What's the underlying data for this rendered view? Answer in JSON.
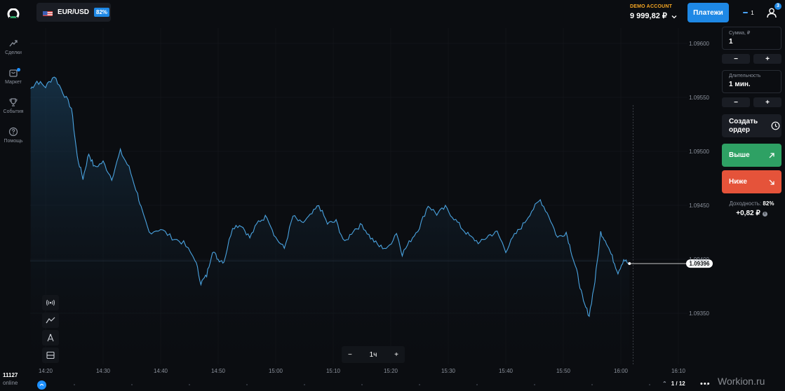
{
  "sidebar": {
    "items": [
      {
        "label": "Сделки",
        "icon": "trades-icon"
      },
      {
        "label": "Маркет",
        "icon": "market-icon"
      },
      {
        "label": "События",
        "icon": "trophy-icon"
      },
      {
        "label": "Помощь",
        "icon": "help-icon"
      }
    ],
    "online_count": "11127",
    "online_label": "online"
  },
  "header": {
    "asset": "EUR/USD",
    "asset_payout": "82%",
    "account_label": "DEMO ACCOUNT",
    "balance": "9 999,82 ₽",
    "payments_label": "Платежи",
    "open_trades": "1",
    "notifications": "3"
  },
  "panel": {
    "amount_label": "Сумма, ₽",
    "amount_value": "1",
    "duration_label": "Длительность",
    "duration_value": "1 мин.",
    "minus": "−",
    "plus": "+",
    "order_label": "Создать ордер",
    "up_label": "Выше",
    "down_label": "Ниже",
    "profit_label": "Доходность:",
    "profit_pct": "82%",
    "profit_value": "+0,82 ₽"
  },
  "toolbar": {
    "timeframe": "1ч",
    "minus": "−",
    "plus": "+",
    "page": "1 / 12",
    "more": "•••"
  },
  "watermark": "Workion.ru",
  "colors": {
    "accent": "#1e88e5",
    "up": "#2ea164",
    "down": "#e5533a",
    "line": "#4aa3e0",
    "demo": "#f5a623"
  },
  "chart_data": {
    "type": "area",
    "current_price": "1.09396",
    "y_ticks": [
      "1.09600",
      "1.09550",
      "1.09500",
      "1.09450",
      "1.09400",
      "1.09350"
    ],
    "x_ticks": [
      "14:20",
      "14:30",
      "14:40",
      "14:50",
      "15:00",
      "15:10",
      "15:20",
      "15:30",
      "15:40",
      "15:50",
      "16:00",
      "16:10"
    ],
    "ylim": [
      1.0932,
      1.0962
    ],
    "x_minutes_range": [
      -1.6,
      110
    ],
    "series": [
      {
        "x": [
          0,
          1.5,
          3,
          4.5,
          6,
          7.5,
          9,
          10.5,
          12,
          13.5,
          15,
          16.5,
          18,
          19.5,
          21,
          22.5,
          24,
          25.5,
          27,
          28.5,
          30,
          31.5,
          33,
          34.5,
          36,
          37.5,
          39,
          40.5,
          42,
          43.5,
          45,
          46.5,
          48,
          49.5,
          51,
          52.5,
          54,
          55.5,
          57,
          58.5,
          60,
          61.5,
          63,
          64.5,
          66,
          67.5,
          69,
          70.5,
          72,
          73.5,
          75,
          76.5,
          78,
          79.5,
          81,
          82.5,
          84,
          85.5,
          87,
          88.5,
          90,
          91.5,
          93,
          94.5,
          96,
          97.5,
          99,
          100.5,
          102,
          103.5,
          105,
          106.5,
          108,
          109.5,
          111,
          112.5,
          114,
          115.5,
          117,
          118.5,
          120,
          121.5,
          123,
          124.5,
          126,
          127.5,
          129,
          130.5,
          132,
          133.5,
          135,
          136.5,
          138,
          139.5,
          141,
          142.5,
          144,
          145.5,
          147,
          148.5,
          150,
          151.5,
          153,
          154.5,
          156,
          157.5,
          159,
          160.5,
          162,
          163.5,
          165,
          166.5,
          168,
          169.5,
          171,
          172.5,
          174,
          175.5,
          177,
          178.5,
          180,
          181.5,
          183,
          184.5,
          186,
          187.5,
          189,
          190.5,
          192,
          193.5,
          195,
          196.5,
          198,
          199.5,
          201,
          202.5,
          204,
          205.5,
          207,
          208.5,
          210,
          211.5,
          213,
          214.5,
          216,
          217.5,
          219,
          220.5,
          222,
          223.5,
          225,
          226.5,
          228,
          229.5,
          231,
          232.5,
          234,
          235.5,
          237,
          238.5,
          240,
          241.5,
          243,
          244.5,
          246,
          247.5,
          249,
          250.5,
          252,
          253.5,
          255,
          256.5,
          258,
          259.5,
          261,
          262.5,
          264,
          265.5,
          267,
          268.5,
          270,
          271.5,
          273,
          274.5,
          276,
          277.5,
          279,
          280.5,
          282,
          283.5,
          285,
          286.5,
          288,
          289.5,
          291,
          292.5,
          294,
          295.5,
          297,
          298.5,
          300,
          301.5,
          303,
          304.5,
          306,
          307.5,
          309,
          310.5,
          312,
          313.5,
          315,
          316.5,
          318,
          319.5,
          321,
          322.5,
          324,
          325.5,
          327,
          328.5,
          330,
          331.5,
          333,
          334.5,
          336,
          337.5,
          339,
          340.5,
          342,
          343.5,
          345,
          346.5,
          348,
          349.5,
          351,
          352.5,
          354,
          355.5,
          357,
          358.5,
          360,
          361.5,
          363,
          364.5,
          366,
          367.5,
          369,
          370.5,
          372,
          373.5,
          375,
          376.5,
          378,
          379.5,
          381,
          382.5,
          384,
          385.5,
          387,
          388.5,
          390,
          391.5,
          393,
          394.5,
          396,
          397.5,
          399,
          400.5,
          402,
          403.5,
          405,
          406.5,
          408,
          409.5,
          411,
          412.5,
          414,
          415.5,
          417,
          418.5,
          420,
          421.5,
          423,
          424.5
        ],
        "y_note": "offsets"
      }
    ]
  }
}
